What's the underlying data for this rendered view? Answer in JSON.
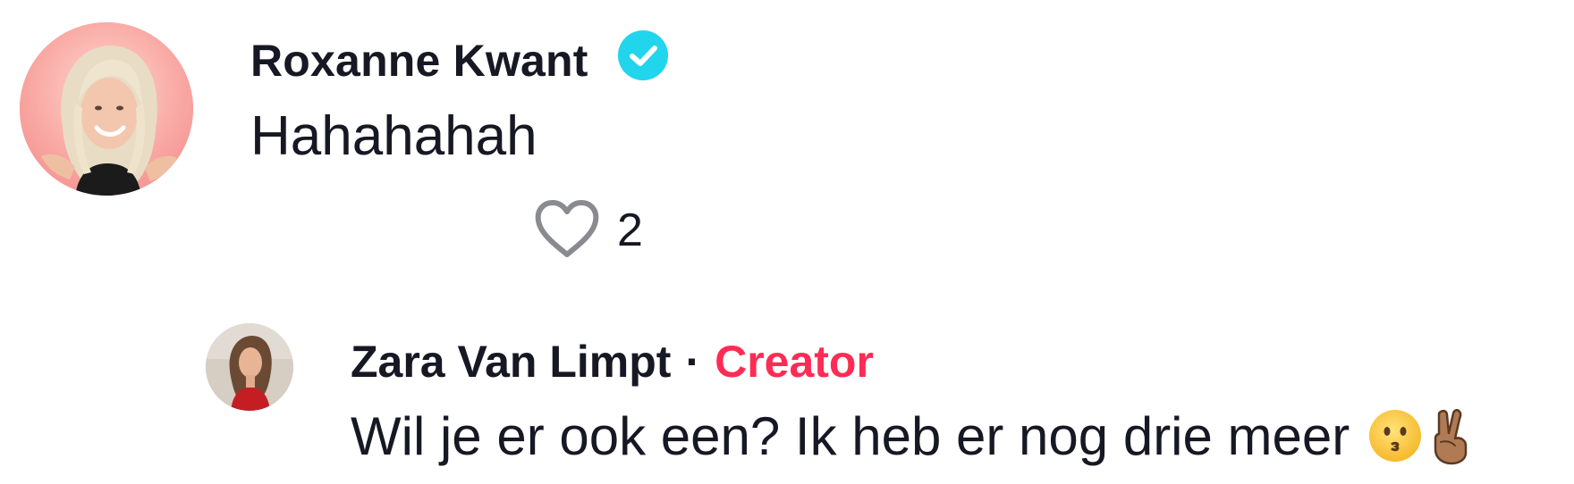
{
  "comment": {
    "author": "Roxanne Kwant",
    "verified": true,
    "text": "Hahahahah",
    "likes": "2",
    "avatar_icon": "avatar-photo",
    "verified_icon": "verified-badge-icon",
    "like_icon": "heart-outline-icon"
  },
  "reply": {
    "author": "Zara Van Limpt",
    "separator": "·",
    "role_badge": "Creator",
    "text": "Wil je er ook een? Ik heb er nog drie meer",
    "emojis": [
      "kissing-face-emoji",
      "victory-hand-medium-dark-emoji"
    ],
    "avatar_icon": "avatar-photo"
  },
  "colors": {
    "text": "#161823",
    "creator_badge": "#fe2c55",
    "verified": "#20d5ec",
    "heart_outline": "#8a8b91"
  }
}
